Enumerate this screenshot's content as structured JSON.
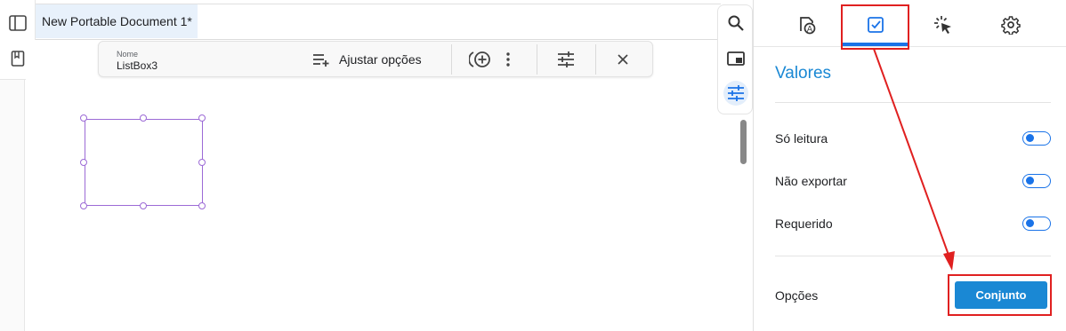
{
  "document_tab": {
    "title": "New Portable Document 1*"
  },
  "toolbar": {
    "name_label": "Nome",
    "name_value": "ListBox3",
    "adjust_options_label": "Ajustar opções"
  },
  "panel": {
    "section_title": "Valores",
    "rows": [
      {
        "label": "Só leitura",
        "toggle": "off"
      },
      {
        "label": "Não exportar",
        "toggle": "off"
      },
      {
        "label": "Requerido",
        "toggle": "off"
      }
    ],
    "options_label": "Opções",
    "set_button_label": "Conjunto"
  },
  "colors": {
    "accent": "#1a73e8",
    "button": "#1a88d4",
    "highlight": "#e02020",
    "selection": "#9c6ad6"
  },
  "icons": {
    "left_rail": [
      "sidebar-panel-icon",
      "bookmark-icon"
    ],
    "right_rail": [
      "search-icon",
      "window-panel-icon",
      "sliders-icon"
    ],
    "panel_tabs": [
      "form-field-icon",
      "checkbox-icon",
      "click-action-icon",
      "gear-icon"
    ],
    "toolbar": [
      "playlist-add-icon",
      "add-circle-icon",
      "more-vertical-icon",
      "tune-icon",
      "close-icon"
    ]
  }
}
